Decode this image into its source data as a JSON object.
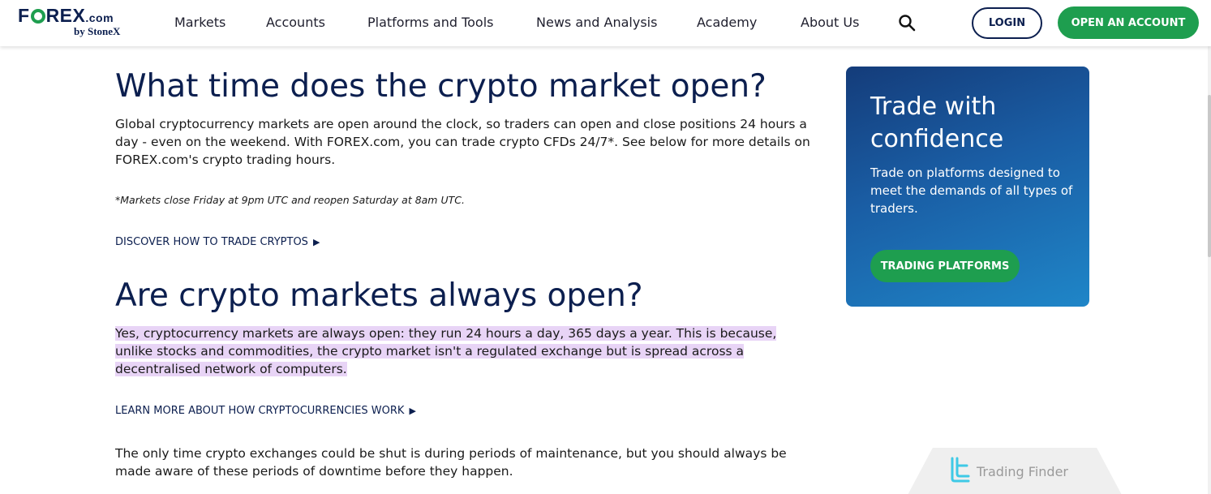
{
  "header": {
    "logo_main": "FOREX",
    "logo_dotcom": ".com",
    "logo_sub": "by StoneX",
    "nav": [
      {
        "label": "Markets"
      },
      {
        "label": "Accounts"
      },
      {
        "label": "Platforms and Tools"
      },
      {
        "label": "News and Analysis"
      },
      {
        "label": "Academy"
      },
      {
        "label": "About Us"
      }
    ],
    "search_icon": "search-icon",
    "login_label": "LOGIN",
    "open_account_label": "OPEN AN ACCOUNT"
  },
  "main": {
    "heading1": "What time does the crypto market open?",
    "para1": "Global cryptocurrency markets are open around the clock, so traders can open and close positions 24 hours a day - even on the weekend. With FOREX.com, you can trade crypto CFDs 24/7*. See below for more details on FOREX.com's crypto trading hours.",
    "note": "*Markets close Friday at 9pm UTC and reopen Saturday at 8am UTC.",
    "link1": "DISCOVER HOW TO TRADE CRYPTOS",
    "heading2": "Are crypto markets always open?",
    "para2": "Yes, cryptocurrency markets are always open: they run 24 hours a day, 365 days a year. This is because, unlike stocks and commodities, the crypto market isn't a regulated exchange but is spread across a decentralised network of computers.",
    "link2": "LEARN MORE ABOUT HOW CRYPTOCURRENCIES WORK",
    "para3": "The only time crypto exchanges could be shut is during periods of maintenance, but you should always be made aware of these periods of downtime before they happen."
  },
  "promo": {
    "title": "Trade with confidence",
    "text": "Trade on platforms designed to meet the demands of all types of traders.",
    "button": "TRADING PLATFORMS"
  },
  "watermark": {
    "text": "Trading Finder"
  },
  "colors": {
    "navy": "#0c1f4f",
    "green": "#1e9e4f",
    "highlight": "#e8d4f6",
    "promo_gradient_start": "#143c7a",
    "promo_gradient_end": "#1f86c8"
  }
}
